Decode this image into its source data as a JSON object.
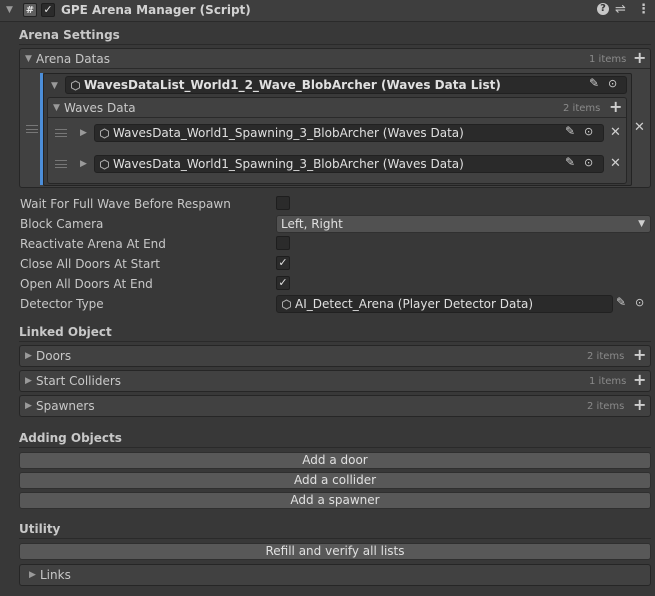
{
  "header": {
    "title": "GPE Arena Manager (Script)",
    "enabled_checked": true
  },
  "arena_settings": {
    "label": "Arena Settings",
    "arena_datas": {
      "label": "Arena Datas",
      "count": "1 items",
      "element_value": "WavesDataList_World1_2_Wave_BlobArcher (Waves Data List)",
      "waves_data": {
        "label": "Waves Data",
        "count": "2 items",
        "items": [
          {
            "value": "WavesData_World1_Spawning_3_BlobArcher (Waves Data)"
          },
          {
            "value": "WavesData_World1_Spawning_3_BlobArcher (Waves Data)"
          }
        ]
      }
    },
    "properties": [
      {
        "label": "Wait For Full Wave Before Respawn",
        "type": "checkbox",
        "checked": false
      },
      {
        "label": "Block Camera",
        "type": "dropdown",
        "value": "Left, Right"
      },
      {
        "label": "Reactivate Arena At End",
        "type": "checkbox",
        "checked": false
      },
      {
        "label": "Close All Doors At Start",
        "type": "checkbox",
        "checked": true
      },
      {
        "label": "Open All Doors At End",
        "type": "checkbox",
        "checked": true
      },
      {
        "label": "Detector Type",
        "type": "object",
        "value": "AI_Detect_Arena (Player Detector Data)"
      }
    ]
  },
  "linked_object": {
    "label": "Linked Object",
    "lists": [
      {
        "label": "Doors",
        "count": "2 items"
      },
      {
        "label": "Start Colliders",
        "count": "1 items"
      },
      {
        "label": "Spawners",
        "count": "2 items"
      }
    ]
  },
  "adding_objects": {
    "label": "Adding Objects",
    "buttons": [
      "Add a door",
      "Add a collider",
      "Add a spawner"
    ]
  },
  "utility": {
    "label": "Utility",
    "refill_button": "Refill and verify all lists",
    "links_label": "Links"
  },
  "colors": {
    "accent": "#4c8ed9",
    "background": "#383838",
    "field": "#2a2a2a"
  },
  "icons": [
    "script-icon",
    "help-icon",
    "preset-icon",
    "kebab-menu-icon",
    "scriptable-object-icon",
    "pencil-icon",
    "object-picker-icon",
    "plus-icon",
    "remove-icon",
    "drag-handle-icon",
    "foldout-arrow-icon",
    "dropdown-arrow-icon",
    "checkmark-icon"
  ]
}
